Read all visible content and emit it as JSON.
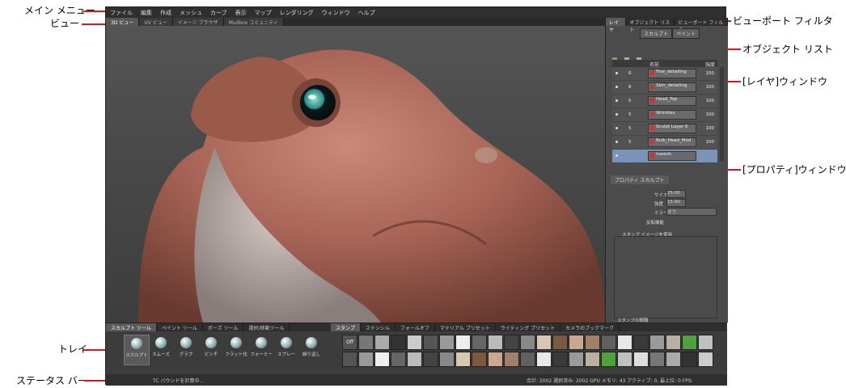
{
  "callouts": {
    "main_menu": "メイン メニュー",
    "view": "ビュー",
    "viewport_filter": "ビューポート フィルタ",
    "object_list": "オブジェクト リスト",
    "layers_window": "[レイヤ]ウィンドウ",
    "properties_window": "[プロパティ]ウィンドウ",
    "tray": "トレイ",
    "status_bar": "ステータス バー"
  },
  "menu": [
    "ファイル",
    "編集",
    "作成",
    "メッシュ",
    "カーブ",
    "表示",
    "マップ",
    "レンダリング",
    "ウィンドウ",
    "ヘルプ"
  ],
  "view_tabs": [
    "3D ビュー",
    "UV ビュー",
    "イメージ ブラウザ",
    "Mudbox コミュニティ"
  ],
  "right_tabs": [
    "レイヤ",
    "オブジェクト リスト",
    "ビューポート フィルタ"
  ],
  "sub_tabs": [
    "スカルプト",
    "ペイント"
  ],
  "layer_header": {
    "name": "名前",
    "strength": "強度"
  },
  "layers": [
    {
      "num": "6",
      "name": "Fine_detailing",
      "weight": "100"
    },
    {
      "num": "6",
      "name": "Skin_detailing",
      "weight": "100"
    },
    {
      "num": "5",
      "name": "Head_Top",
      "weight": "100"
    },
    {
      "num": "5",
      "name": "Wrinkles",
      "weight": "100"
    },
    {
      "num": "5",
      "name": "Sculpt Layer 6",
      "weight": "100"
    },
    {
      "num": "5",
      "name": "Bulk_Head_Mod",
      "weight": "100"
    },
    {
      "num": "",
      "name": "lowesh",
      "weight": ""
    }
  ],
  "properties": {
    "title": "プロパティ スカルプト",
    "size_label": "サイズ",
    "size_value": "25.00",
    "strength_label": "強度",
    "strength_value": "15.00",
    "mirror_label": "ミラー",
    "mirror_value": "オフ",
    "invert_label": "反転機能",
    "stamp_image": "スタンプ イメージを使用",
    "stamp_spacing": "スタンプの間隔"
  },
  "tray_tabs_left": [
    "スカルプト ツール",
    "ペイント ツール",
    "ポーズ ツール",
    "選択/移動ツール"
  ],
  "tools": [
    "スカルプト",
    "スムーズ",
    "グラブ",
    "ピンチ",
    "フラット化",
    "フォーミー",
    "スプレー",
    "繰り返し"
  ],
  "tray_tabs_right": [
    "スタンプ",
    "ステンシル",
    "フォールオフ",
    "マテリアル プリセット",
    "ライティング プリセット",
    "カメラのブックマーク"
  ],
  "stamp_off": "Off",
  "status": {
    "left": "TC バウンドを計算中...",
    "right": "合計: 2002   選択済み: 2002 GPU メモリ: 43  アクティブ: 0, 最上位: 0   FPS:"
  }
}
